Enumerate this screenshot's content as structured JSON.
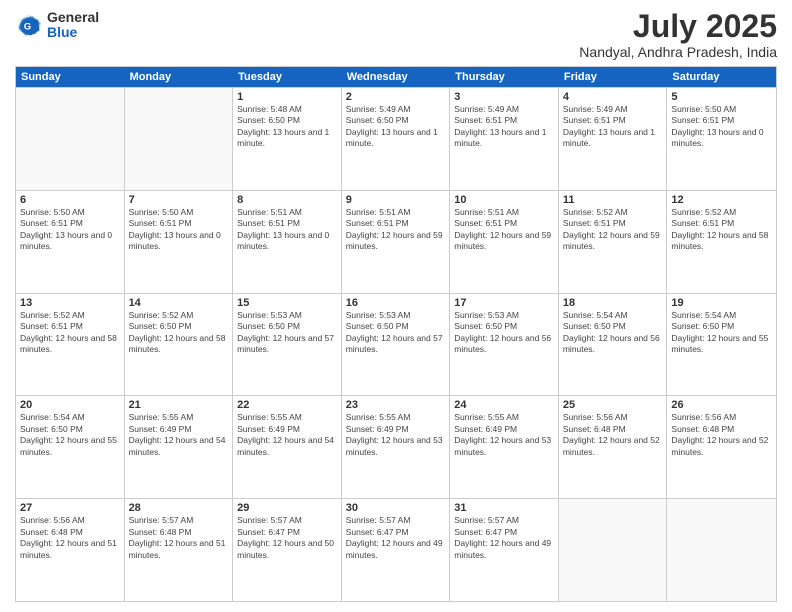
{
  "logo": {
    "general": "General",
    "blue": "Blue"
  },
  "title": "July 2025",
  "subtitle": "Nandyal, Andhra Pradesh, India",
  "header_days": [
    "Sunday",
    "Monday",
    "Tuesday",
    "Wednesday",
    "Thursday",
    "Friday",
    "Saturday"
  ],
  "weeks": [
    [
      {
        "day": "",
        "info": "",
        "empty": true
      },
      {
        "day": "",
        "info": "",
        "empty": true
      },
      {
        "day": "1",
        "info": "Sunrise: 5:48 AM\nSunset: 6:50 PM\nDaylight: 13 hours and 1 minute."
      },
      {
        "day": "2",
        "info": "Sunrise: 5:49 AM\nSunset: 6:50 PM\nDaylight: 13 hours and 1 minute."
      },
      {
        "day": "3",
        "info": "Sunrise: 5:49 AM\nSunset: 6:51 PM\nDaylight: 13 hours and 1 minute."
      },
      {
        "day": "4",
        "info": "Sunrise: 5:49 AM\nSunset: 6:51 PM\nDaylight: 13 hours and 1 minute."
      },
      {
        "day": "5",
        "info": "Sunrise: 5:50 AM\nSunset: 6:51 PM\nDaylight: 13 hours and 0 minutes."
      }
    ],
    [
      {
        "day": "6",
        "info": "Sunrise: 5:50 AM\nSunset: 6:51 PM\nDaylight: 13 hours and 0 minutes."
      },
      {
        "day": "7",
        "info": "Sunrise: 5:50 AM\nSunset: 6:51 PM\nDaylight: 13 hours and 0 minutes."
      },
      {
        "day": "8",
        "info": "Sunrise: 5:51 AM\nSunset: 6:51 PM\nDaylight: 13 hours and 0 minutes."
      },
      {
        "day": "9",
        "info": "Sunrise: 5:51 AM\nSunset: 6:51 PM\nDaylight: 12 hours and 59 minutes."
      },
      {
        "day": "10",
        "info": "Sunrise: 5:51 AM\nSunset: 6:51 PM\nDaylight: 12 hours and 59 minutes."
      },
      {
        "day": "11",
        "info": "Sunrise: 5:52 AM\nSunset: 6:51 PM\nDaylight: 12 hours and 59 minutes."
      },
      {
        "day": "12",
        "info": "Sunrise: 5:52 AM\nSunset: 6:51 PM\nDaylight: 12 hours and 58 minutes."
      }
    ],
    [
      {
        "day": "13",
        "info": "Sunrise: 5:52 AM\nSunset: 6:51 PM\nDaylight: 12 hours and 58 minutes."
      },
      {
        "day": "14",
        "info": "Sunrise: 5:52 AM\nSunset: 6:50 PM\nDaylight: 12 hours and 58 minutes."
      },
      {
        "day": "15",
        "info": "Sunrise: 5:53 AM\nSunset: 6:50 PM\nDaylight: 12 hours and 57 minutes."
      },
      {
        "day": "16",
        "info": "Sunrise: 5:53 AM\nSunset: 6:50 PM\nDaylight: 12 hours and 57 minutes."
      },
      {
        "day": "17",
        "info": "Sunrise: 5:53 AM\nSunset: 6:50 PM\nDaylight: 12 hours and 56 minutes."
      },
      {
        "day": "18",
        "info": "Sunrise: 5:54 AM\nSunset: 6:50 PM\nDaylight: 12 hours and 56 minutes."
      },
      {
        "day": "19",
        "info": "Sunrise: 5:54 AM\nSunset: 6:50 PM\nDaylight: 12 hours and 55 minutes."
      }
    ],
    [
      {
        "day": "20",
        "info": "Sunrise: 5:54 AM\nSunset: 6:50 PM\nDaylight: 12 hours and 55 minutes."
      },
      {
        "day": "21",
        "info": "Sunrise: 5:55 AM\nSunset: 6:49 PM\nDaylight: 12 hours and 54 minutes."
      },
      {
        "day": "22",
        "info": "Sunrise: 5:55 AM\nSunset: 6:49 PM\nDaylight: 12 hours and 54 minutes."
      },
      {
        "day": "23",
        "info": "Sunrise: 5:55 AM\nSunset: 6:49 PM\nDaylight: 12 hours and 53 minutes."
      },
      {
        "day": "24",
        "info": "Sunrise: 5:55 AM\nSunset: 6:49 PM\nDaylight: 12 hours and 53 minutes."
      },
      {
        "day": "25",
        "info": "Sunrise: 5:56 AM\nSunset: 6:48 PM\nDaylight: 12 hours and 52 minutes."
      },
      {
        "day": "26",
        "info": "Sunrise: 5:56 AM\nSunset: 6:48 PM\nDaylight: 12 hours and 52 minutes."
      }
    ],
    [
      {
        "day": "27",
        "info": "Sunrise: 5:56 AM\nSunset: 6:48 PM\nDaylight: 12 hours and 51 minutes."
      },
      {
        "day": "28",
        "info": "Sunrise: 5:57 AM\nSunset: 6:48 PM\nDaylight: 12 hours and 51 minutes."
      },
      {
        "day": "29",
        "info": "Sunrise: 5:57 AM\nSunset: 6:47 PM\nDaylight: 12 hours and 50 minutes."
      },
      {
        "day": "30",
        "info": "Sunrise: 5:57 AM\nSunset: 6:47 PM\nDaylight: 12 hours and 49 minutes."
      },
      {
        "day": "31",
        "info": "Sunrise: 5:57 AM\nSunset: 6:47 PM\nDaylight: 12 hours and 49 minutes."
      },
      {
        "day": "",
        "info": "",
        "empty": true
      },
      {
        "day": "",
        "info": "",
        "empty": true
      }
    ]
  ]
}
